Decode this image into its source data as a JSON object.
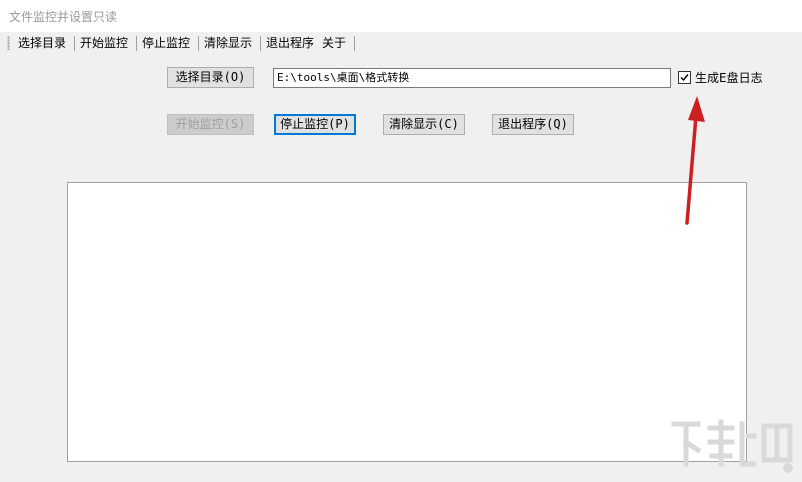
{
  "window": {
    "title": "文件监控并设置只读"
  },
  "menu": {
    "items": [
      {
        "label": "选择目录"
      },
      {
        "label": "开始监控"
      },
      {
        "label": "停止监控"
      },
      {
        "label": "清除显示"
      },
      {
        "label": "退出程序"
      },
      {
        "label": "关于"
      }
    ]
  },
  "main": {
    "select_dir_label": "选择目录(O)",
    "path_value": "E:\\tools\\桌面\\格式转换",
    "checkbox_label": "生成E盘日志",
    "checkbox_checked": true,
    "start_label": "开始监控(S)",
    "stop_label": "停止监控(P)",
    "clear_label": "清除显示(C)",
    "exit_label": "退出程序(Q)",
    "log_lines": []
  },
  "annotation": {
    "arrow_color": "#cc1f1f"
  },
  "icons": [
    "checkmark-icon",
    "menu-grip-icon",
    "red-arrow-icon",
    "watermark-logo-icon"
  ]
}
